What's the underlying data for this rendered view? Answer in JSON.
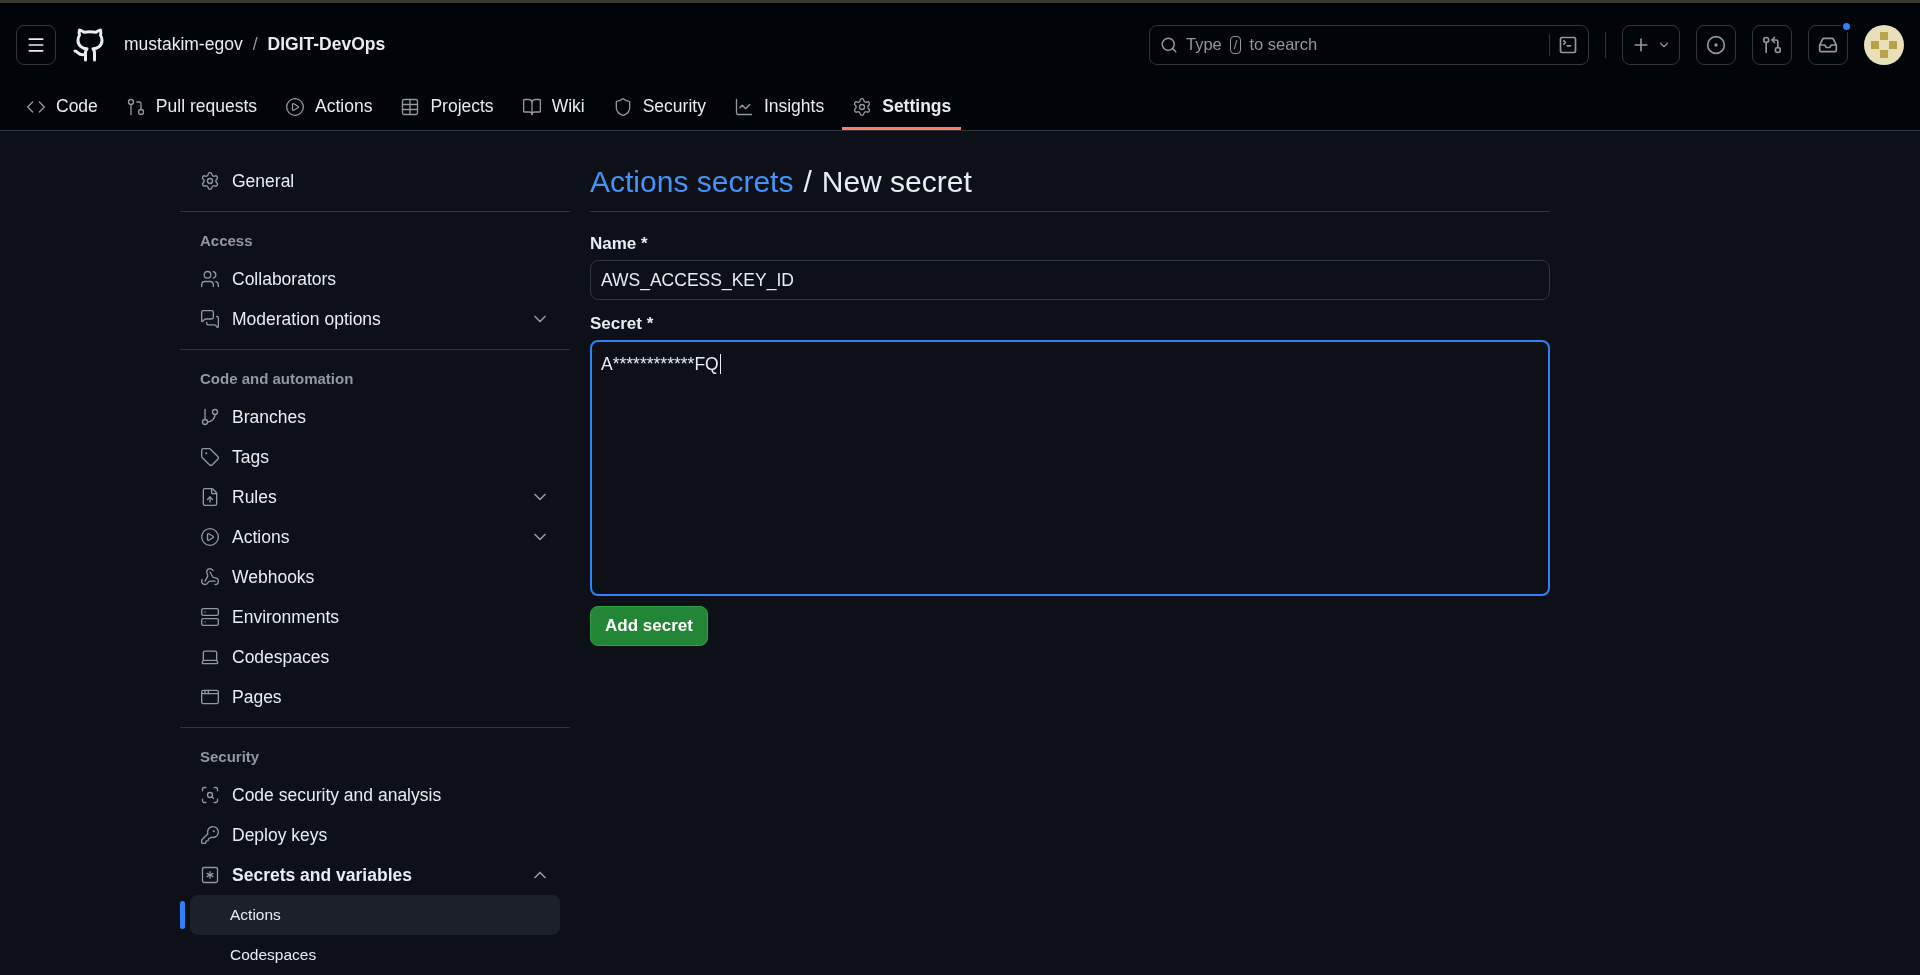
{
  "header": {
    "owner": "mustakim-egov",
    "separator": "/",
    "repo": "DIGIT-DevOps",
    "search": {
      "placeholder_before": "Type",
      "key": "/",
      "placeholder_after": "to search"
    },
    "notifications_unread": true
  },
  "tabs": [
    {
      "label": "Code",
      "selected": false
    },
    {
      "label": "Pull requests",
      "selected": false
    },
    {
      "label": "Actions",
      "selected": false
    },
    {
      "label": "Projects",
      "selected": false
    },
    {
      "label": "Wiki",
      "selected": false
    },
    {
      "label": "Security",
      "selected": false
    },
    {
      "label": "Insights",
      "selected": false
    },
    {
      "label": "Settings",
      "selected": true
    }
  ],
  "sidebar": {
    "sections": [
      {
        "items": [
          {
            "label": "General"
          }
        ]
      },
      {
        "heading": "Access",
        "items": [
          {
            "label": "Collaborators"
          },
          {
            "label": "Moderation options",
            "expanded": false
          }
        ]
      },
      {
        "heading": "Code and automation",
        "items": [
          {
            "label": "Branches"
          },
          {
            "label": "Tags"
          },
          {
            "label": "Rules",
            "expanded": false
          },
          {
            "label": "Actions",
            "expanded": false
          },
          {
            "label": "Webhooks"
          },
          {
            "label": "Environments"
          },
          {
            "label": "Codespaces"
          },
          {
            "label": "Pages"
          }
        ]
      },
      {
        "heading": "Security",
        "items": [
          {
            "label": "Code security and analysis"
          },
          {
            "label": "Deploy keys"
          },
          {
            "label": "Secrets and variables",
            "expanded": true,
            "children": [
              {
                "label": "Actions",
                "selected": true
              },
              {
                "label": "Codespaces",
                "selected": false
              }
            ]
          }
        ]
      }
    ]
  },
  "main": {
    "breadcrumb_link": "Actions secrets",
    "breadcrumb_separator": "/",
    "title": "New secret",
    "name_label": "Name *",
    "name_value": "AWS_ACCESS_KEY_ID",
    "secret_label": "Secret *",
    "secret_value": "A************FQ",
    "secret_focused": true,
    "submit": "Add secret"
  }
}
